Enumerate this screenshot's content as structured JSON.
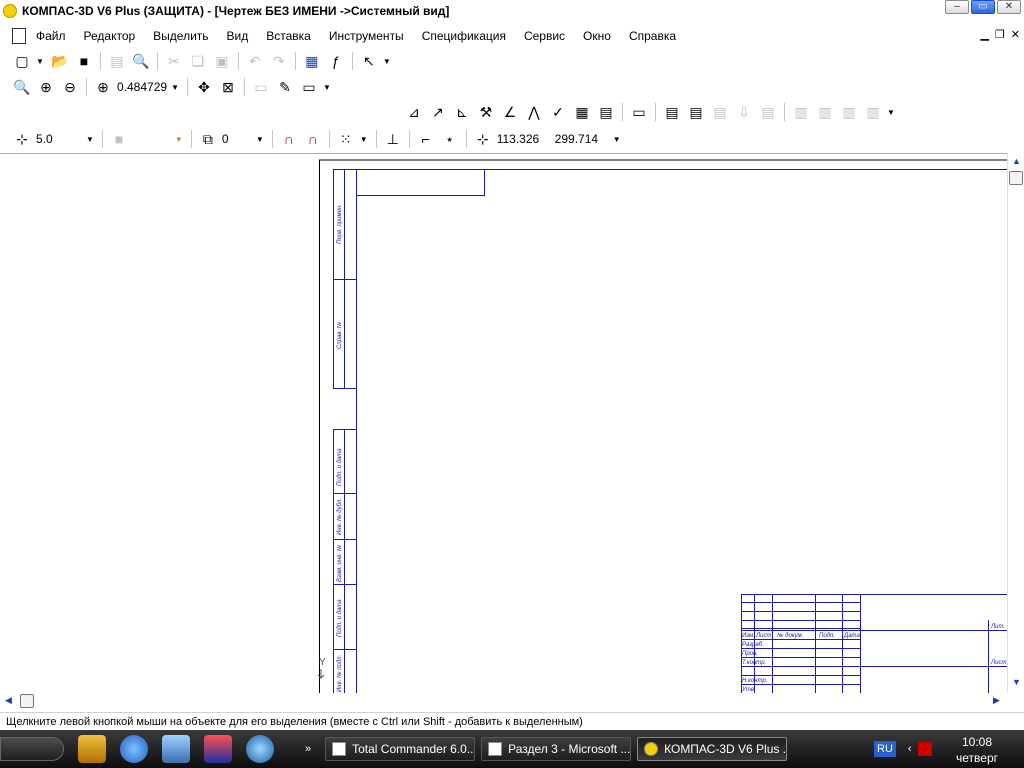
{
  "window": {
    "title": "КОМПАС-3D V6 Plus (ЗАЩИТА) - [Чертеж БЕЗ ИМЕНИ -&gt;Системный вид]",
    "min_label": "–",
    "max_label": "▭",
    "close_label": "✕"
  },
  "menu": [
    {
      "label": "Файл"
    },
    {
      "label": "Редактор"
    },
    {
      "label": "Выделить"
    },
    {
      "label": "Вид"
    },
    {
      "label": "Вставка"
    },
    {
      "label": "Инструменты"
    },
    {
      "label": "Спецификация"
    },
    {
      "label": "Сервис"
    },
    {
      "label": "Окно"
    },
    {
      "label": "Справка"
    }
  ],
  "toolbar_view": {
    "zoom_value": "0.484729"
  },
  "toolbar_params": {
    "step_value": "5.0",
    "layer_value": "0",
    "coord_x": "113.326",
    "coord_y": "299.714"
  },
  "stamp_labels": {
    "perv_primen": "Перв. примен.",
    "sprav_no": "Справ. №",
    "podp_data_1": "Подп. и дата",
    "inv_no_dubl": "Инв. № дубл.",
    "vzam_inv_no": "Взам. инв. №",
    "podp_data_2": "Подп. и дата",
    "inv_no_podl": "Инв. № подл."
  },
  "title_block": {
    "izm": "Изм.",
    "list": "Лист",
    "doc_no": "№ докум.",
    "podp": "Подп.",
    "data": "Дата",
    "razrab": "Разраб.",
    "prov": "Пров.",
    "t_kontr": "Т.контр.",
    "n_kontr": "Н.контр.",
    "utv": "Утв.",
    "lit": "Лит.",
    "list2": "Лист"
  },
  "axis_label": "Y",
  "status_text": "Щелкните левой кнопкой мыши на объекте для его выделения (вместе с Ctrl или Shift - добавить к выделенным)",
  "taskbar": {
    "tasks": [
      {
        "label": "Total Commander 6.0...",
        "active": false
      },
      {
        "label": "Раздел 3 - Microsoft ...",
        "active": false
      },
      {
        "label": "КОМПАС-3D V6 Plus ...",
        "active": true
      }
    ],
    "lang": "RU",
    "time": "10:08",
    "day": "четверг"
  },
  "colors": {
    "drawing_line": "#1a1aa6",
    "accent": "#2f69d8"
  }
}
